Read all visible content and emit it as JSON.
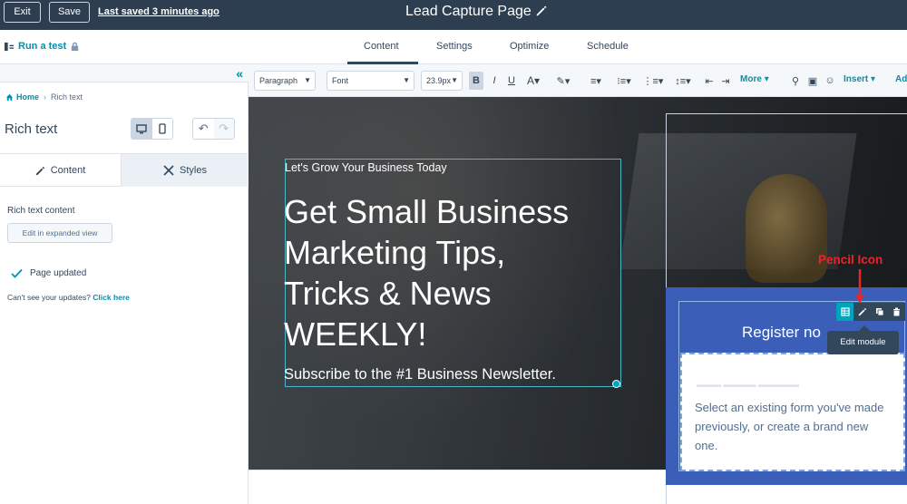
{
  "topbar": {
    "exit_label": "Exit",
    "save_label": "Save",
    "last_saved": "Last saved 3 minutes ago",
    "page_title": "Lead Capture Page"
  },
  "subnav": {
    "run_test": "Run a test",
    "tabs": [
      {
        "label": "Content",
        "active": true
      },
      {
        "label": "Settings",
        "active": false
      },
      {
        "label": "Optimize",
        "active": false
      },
      {
        "label": "Schedule",
        "active": false
      }
    ]
  },
  "left_panel": {
    "breadcrumb_home": "Home",
    "breadcrumb_current": "Rich text",
    "title": "Rich text",
    "content_tab": "Content",
    "styles_tab": "Styles",
    "rich_text_label": "Rich text content",
    "expand_button": "Edit in expanded view",
    "page_updated": "Page updated",
    "cant_see": "Can't see your updates?",
    "click_here": "Click here"
  },
  "editor_toolbar": {
    "paragraph": "Paragraph",
    "font": "Font",
    "font_size": "23.9px",
    "bold": "B",
    "italic": "I",
    "underline": "U",
    "more": "More",
    "insert": "Insert",
    "add": "Ad"
  },
  "canvas": {
    "eyebrow": "Let's Grow Your Business Today",
    "headline_lines": [
      "Get Small Business",
      "Marketing Tips,",
      "Tricks & News",
      "WEEKLY!"
    ],
    "subline": "Subscribe to the #1 Business Newsletter.",
    "register_title": "Register no",
    "form_message": "Select an existing form you've made previously, or create a brand new one.",
    "tooltip": "Edit module"
  },
  "annotation": {
    "label": "Pencil Icon",
    "color": "#e8252b"
  },
  "colors": {
    "topbar": "#2d3e50",
    "accent": "#0091ae",
    "form_bg": "#3b5fb8"
  }
}
